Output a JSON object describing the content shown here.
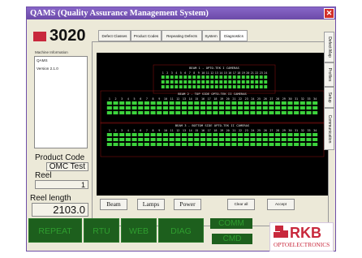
{
  "window": {
    "title": "QAMS (Quality Assurance Management System)",
    "close_glyph": "✕"
  },
  "logo": {
    "text": "3020"
  },
  "machine_info": {
    "heading": "Machine Information",
    "lines": [
      "QAMS",
      "Version 2.1.0"
    ]
  },
  "product_code": {
    "label": "Product Code",
    "value": "OMC Test"
  },
  "reel": {
    "label": "Reel",
    "value": "1"
  },
  "reel_length": {
    "label": "Reel length",
    "value": "2103.0"
  },
  "tabs": [
    "Defect Classes",
    "Product Codes",
    "Repeating Defects",
    "System",
    "Diagnostics"
  ],
  "side_tabs": [
    "Defect Map",
    "Profiles",
    "Setup",
    "Communication"
  ],
  "diagnostics": {
    "beams": [
      {
        "title": "BEAM 1 - OPTO-TEK I CAMERAS",
        "count": 24
      },
      {
        "title": "BEAM 2 - TOP SIDE OPTO-TEK II CAMERAS",
        "count": 34
      },
      {
        "title": "BEAM 3 - BOTTOM SIDE OPTO-TEK II CAMERAS",
        "count": 34
      }
    ]
  },
  "buttons": {
    "beam": "Beam",
    "lamps": "Lamps",
    "power": "Power",
    "clear_all": "Clear all",
    "accept": "Accept"
  },
  "bottom_buttons": {
    "repeat": "REPEAT",
    "rtu": "RTU",
    "web": "WEB",
    "diag": "DIAG",
    "comm": "COMM",
    "cmd": "CMD"
  },
  "brand": {
    "name": "RKB",
    "sub": "OPTOELECTRONICS"
  },
  "colors": {
    "title_bar": "#7555b8",
    "led_green": "#3cd23c",
    "button_green": "#1d5f1d",
    "brand_red": "#c8283c"
  }
}
